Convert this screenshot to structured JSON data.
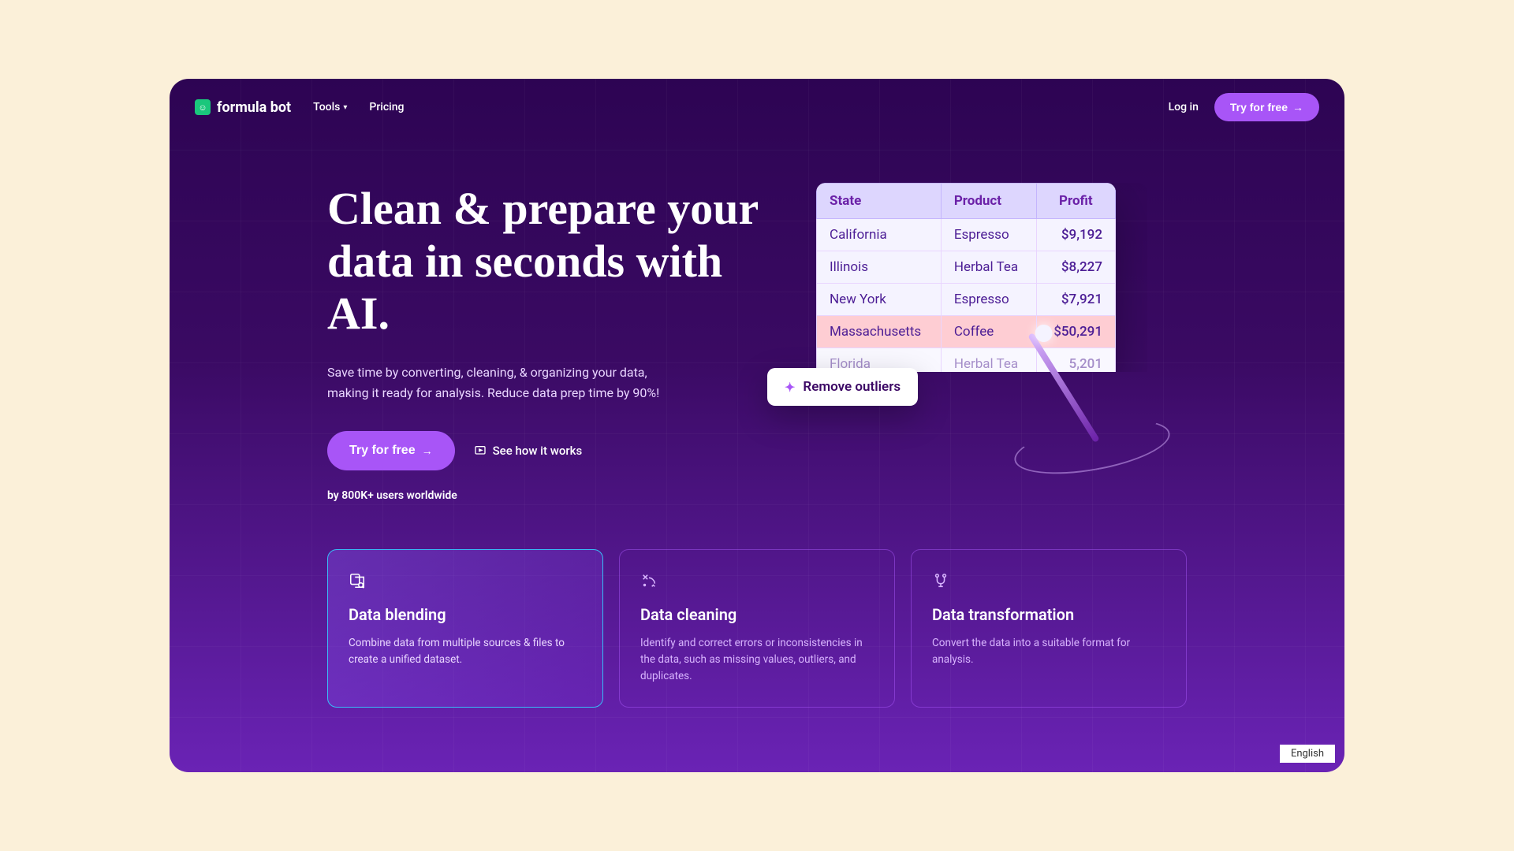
{
  "nav": {
    "brand": "formula bot",
    "tools": "Tools",
    "pricing": "Pricing",
    "login": "Log in",
    "cta": "Try for free"
  },
  "hero": {
    "title": "Clean & prepare your data in seconds with AI.",
    "subtitle": "Save time by converting, cleaning, & organizing your data, making it ready for analysis. Reduce data prep time by 90%!",
    "cta": "Try for free",
    "secondary": "See how it works",
    "users": "by 800K+ users worldwide"
  },
  "table": {
    "headers": {
      "state": "State",
      "product": "Product",
      "profit": "Profit"
    },
    "rows": [
      {
        "state": "California",
        "product": "Espresso",
        "profit": "$9,192"
      },
      {
        "state": "Illinois",
        "product": "Herbal Tea",
        "profit": "$8,227"
      },
      {
        "state": "New York",
        "product": "Espresso",
        "profit": "$7,921"
      },
      {
        "state": "Massachusetts",
        "product": "Coffee",
        "profit": "$50,291"
      },
      {
        "state": "Florida",
        "product": "Herbal Tea",
        "profit": "5,201"
      }
    ]
  },
  "pill": "Remove outliers",
  "cards": [
    {
      "title": "Data blending",
      "desc": "Combine data from multiple sources & files to create a unified dataset."
    },
    {
      "title": "Data cleaning",
      "desc": "Identify and correct errors or inconsistencies in the data, such as missing values, outliers, and duplicates."
    },
    {
      "title": "Data transformation",
      "desc": "Convert the data into a suitable format for analysis."
    }
  ],
  "lang": "English"
}
